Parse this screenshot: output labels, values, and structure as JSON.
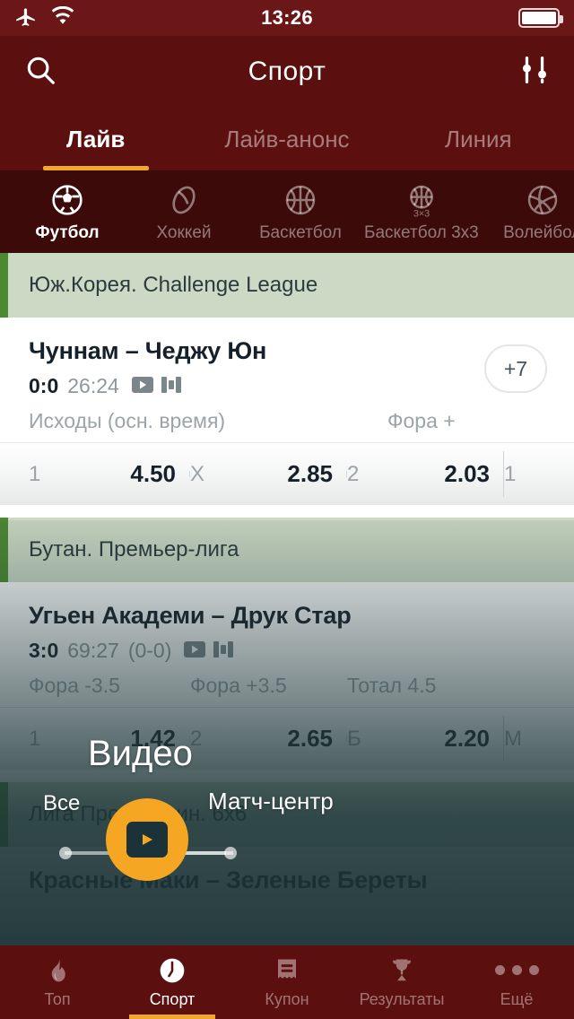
{
  "status_bar": {
    "airplane_icon": "airplane-icon",
    "wifi_icon": "wifi-icon",
    "time": "13:26",
    "battery_icon": "battery-full-icon"
  },
  "nav": {
    "search_icon": "search-icon",
    "title": "Спорт",
    "filter_icon": "filter-sliders-icon"
  },
  "tabs": [
    {
      "label": "Лайв",
      "active": true
    },
    {
      "label": "Лайв-анонс",
      "active": false
    },
    {
      "label": "Линия",
      "active": false
    }
  ],
  "sports": [
    {
      "label": "Футбол",
      "icon": "soccer-ball-icon",
      "active": true
    },
    {
      "label": "Хоккей",
      "icon": "hockey-puck-icon",
      "active": false
    },
    {
      "label": "Баскетбол",
      "icon": "basketball-icon",
      "active": false
    },
    {
      "label": "Баскетбол 3х3",
      "icon": "basketball-3x3-icon",
      "active": false
    },
    {
      "label": "Волейбол",
      "icon": "volleyball-icon",
      "active": false
    }
  ],
  "sections": [
    {
      "league": "Юж.Корея. Challenge League",
      "match": {
        "title": "Чуннам – Чеджу Юн",
        "score": "0:0",
        "time": "26:24",
        "period": "",
        "video_icon": "video-icon",
        "stats_icon": "statistics-icon",
        "more_badge": "+7",
        "markets": [
          {
            "name": "Исходы (осн. время)"
          },
          {
            "name": "Фора +"
          }
        ],
        "odds": [
          {
            "key": "1",
            "value": "4.50"
          },
          {
            "key": "X",
            "value": "2.85"
          },
          {
            "key": "2",
            "value": "2.03"
          },
          {
            "key": "1",
            "value": ""
          }
        ]
      }
    },
    {
      "league": "Бутан. Премьер-лига",
      "match": {
        "title": "Угьен Академи – Друк Стар",
        "score": "3:0",
        "time": "69:27",
        "period": "(0-0)",
        "video_icon": "video-icon",
        "stats_icon": "statistics-icon",
        "more_badge": "",
        "markets": [
          {
            "name": "Фора -3.5"
          },
          {
            "name": "Фора +3.5"
          },
          {
            "name": "Тотал 4.5"
          }
        ],
        "odds": [
          {
            "key": "1",
            "value": "1.42"
          },
          {
            "key": "2",
            "value": "2.65"
          },
          {
            "key": "Б",
            "value": "2.20"
          },
          {
            "key": "М",
            "value": ""
          }
        ]
      }
    },
    {
      "league": "Лига Про. 30 мин. 6х6",
      "match": {
        "title": "Красные Маки – Зеленые Береты",
        "score": "",
        "time": "",
        "period": "",
        "video_icon": "",
        "stats_icon": "",
        "more_badge": "",
        "markets": [],
        "odds": []
      }
    }
  ],
  "overlay": {
    "video_label": "Видео",
    "all_label": "Все",
    "match_center_label": "Матч-центр",
    "play_icon": "play-icon",
    "accent_color": "#f5a623"
  },
  "bottom_nav": [
    {
      "label": "Топ",
      "icon": "flame-icon",
      "active": false
    },
    {
      "label": "Спорт",
      "icon": "clock-icon",
      "active": true
    },
    {
      "label": "Купон",
      "icon": "receipt-icon",
      "active": false
    },
    {
      "label": "Результаты",
      "icon": "trophy-icon",
      "active": false
    },
    {
      "label": "Ещё",
      "icon": "ellipsis-icon",
      "active": false
    }
  ],
  "colors": {
    "brand_dark": "#5c0f0f",
    "brand_darker": "#3d0a0a",
    "accent": "#f2a62c",
    "league_bg": "#ccd9c4",
    "league_bar": "#4c8a30"
  }
}
